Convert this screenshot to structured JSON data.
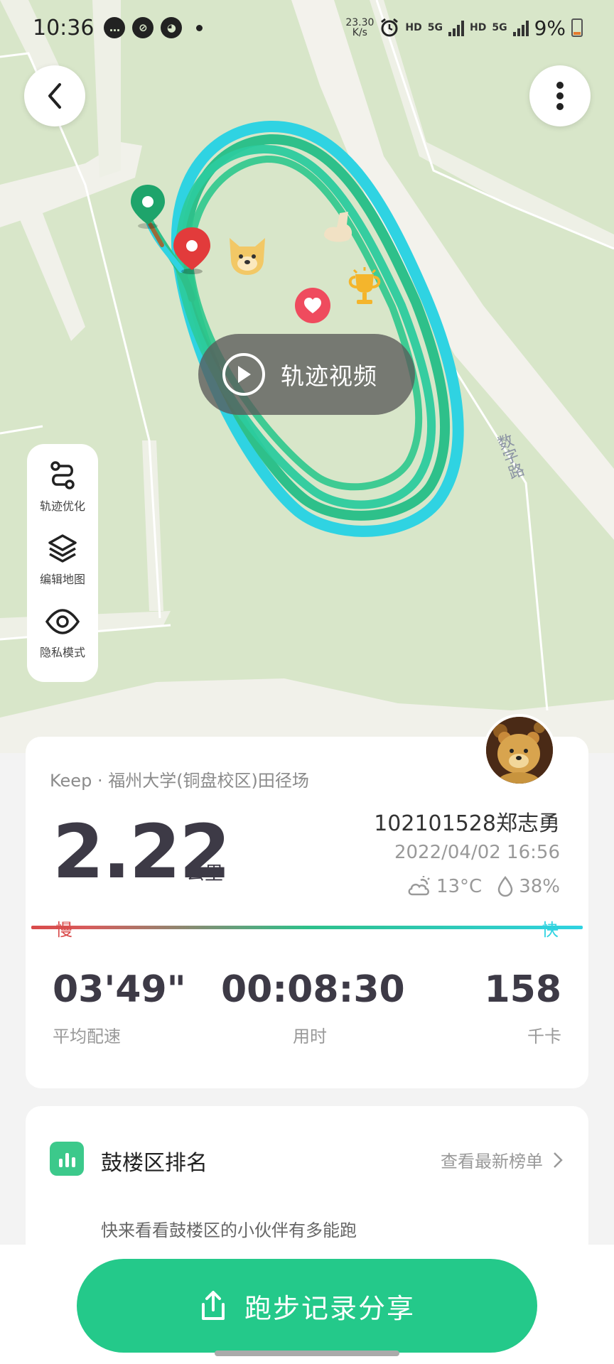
{
  "status_bar": {
    "time": "10:36",
    "net_speed_value": "23.30",
    "net_speed_unit": "K/s",
    "hd1": "HD",
    "sig1": "5G",
    "hd2": "HD",
    "sig2": "5G",
    "battery": "9%"
  },
  "map": {
    "video_label": "轨迹视频",
    "road_label": "数字路",
    "tools": [
      {
        "label": "轨迹优化",
        "icon": "route-icon"
      },
      {
        "label": "编辑地图",
        "icon": "layers-icon"
      },
      {
        "label": "隐私模式",
        "icon": "eye-icon"
      }
    ]
  },
  "stats": {
    "venue": "Keep · 福州大学(铜盘校区)田径场",
    "distance": "2.22",
    "distance_unit": "公里",
    "username": "102101528郑志勇",
    "datetime": "2022/04/02 16:56",
    "temperature": "13°C",
    "humidity": "38%",
    "slow_label": "慢",
    "fast_label": "快",
    "pace_value": "03'49\"",
    "pace_label": "平均配速",
    "duration_value": "00:08:30",
    "duration_label": "用时",
    "calories_value": "158",
    "calories_label": "千卡"
  },
  "rank": {
    "title": "鼓楼区排名",
    "link": "查看最新榜单",
    "subtitle": "快来看看鼓楼区的小伙伴有多能跑"
  },
  "share": {
    "label": "跑步记录分享"
  },
  "colors": {
    "accent": "#24c98a",
    "track_green": "#2ec08a",
    "track_cyan": "#2fd3e2",
    "slow_red": "#d94a4a"
  }
}
